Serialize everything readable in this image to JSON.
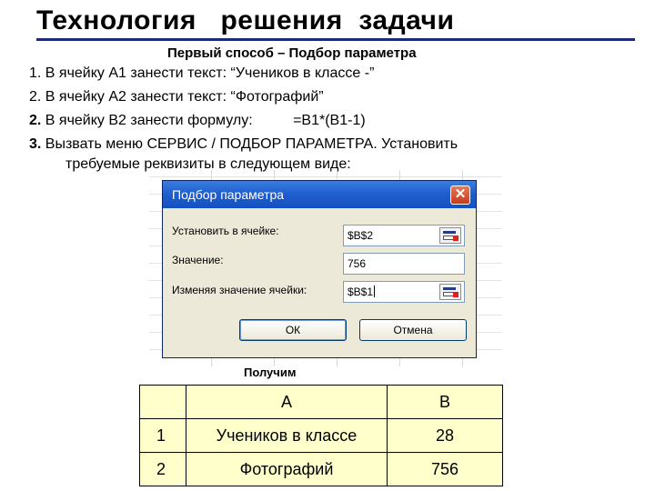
{
  "slide": {
    "title": "Технология   решения  задачи",
    "subtitle": "Первый способ – Подбор параметра",
    "steps": [
      {
        "num": "1.",
        "text": " В ячейку А1 занести текст: “Учеников в классе -”"
      },
      {
        "num": "2.",
        "text": " В ячейку А2 занести текст: “Фотографий”"
      },
      {
        "num": "2.",
        "text": " В ячейку В2 занести формулу:          =В1*(В1-1)"
      },
      {
        "num": "3.",
        "text": " Вызвать меню СЕРВИС / ПОДБОР ПАРАМЕТРА. Установить"
      }
    ],
    "step3_cont": "требуемые реквизиты в следующем виде:",
    "result_label": "Получим"
  },
  "dialog": {
    "title": "Подбор параметра",
    "close_glyph": "✕",
    "set_cell_label": "Установить в ячейке:",
    "set_cell_value": "$B$2",
    "value_label": "Значение:",
    "value_value": "756",
    "changing_label": "Изменяя значение ячейки:",
    "changing_value": "$B$1",
    "ok_label": "ОК",
    "cancel_label": "Отмена"
  },
  "table": {
    "headers": [
      "",
      "A",
      "B"
    ],
    "rows": [
      {
        "num": "1",
        "a": "Учеников в классе",
        "b": "28"
      },
      {
        "num": "2",
        "a": "Фотографий",
        "b": "756"
      }
    ]
  },
  "colors": {
    "title_rule": "#1c2a78",
    "dialog_title_bar": "#1f5fd0",
    "table_bg": "#ffffcc"
  }
}
